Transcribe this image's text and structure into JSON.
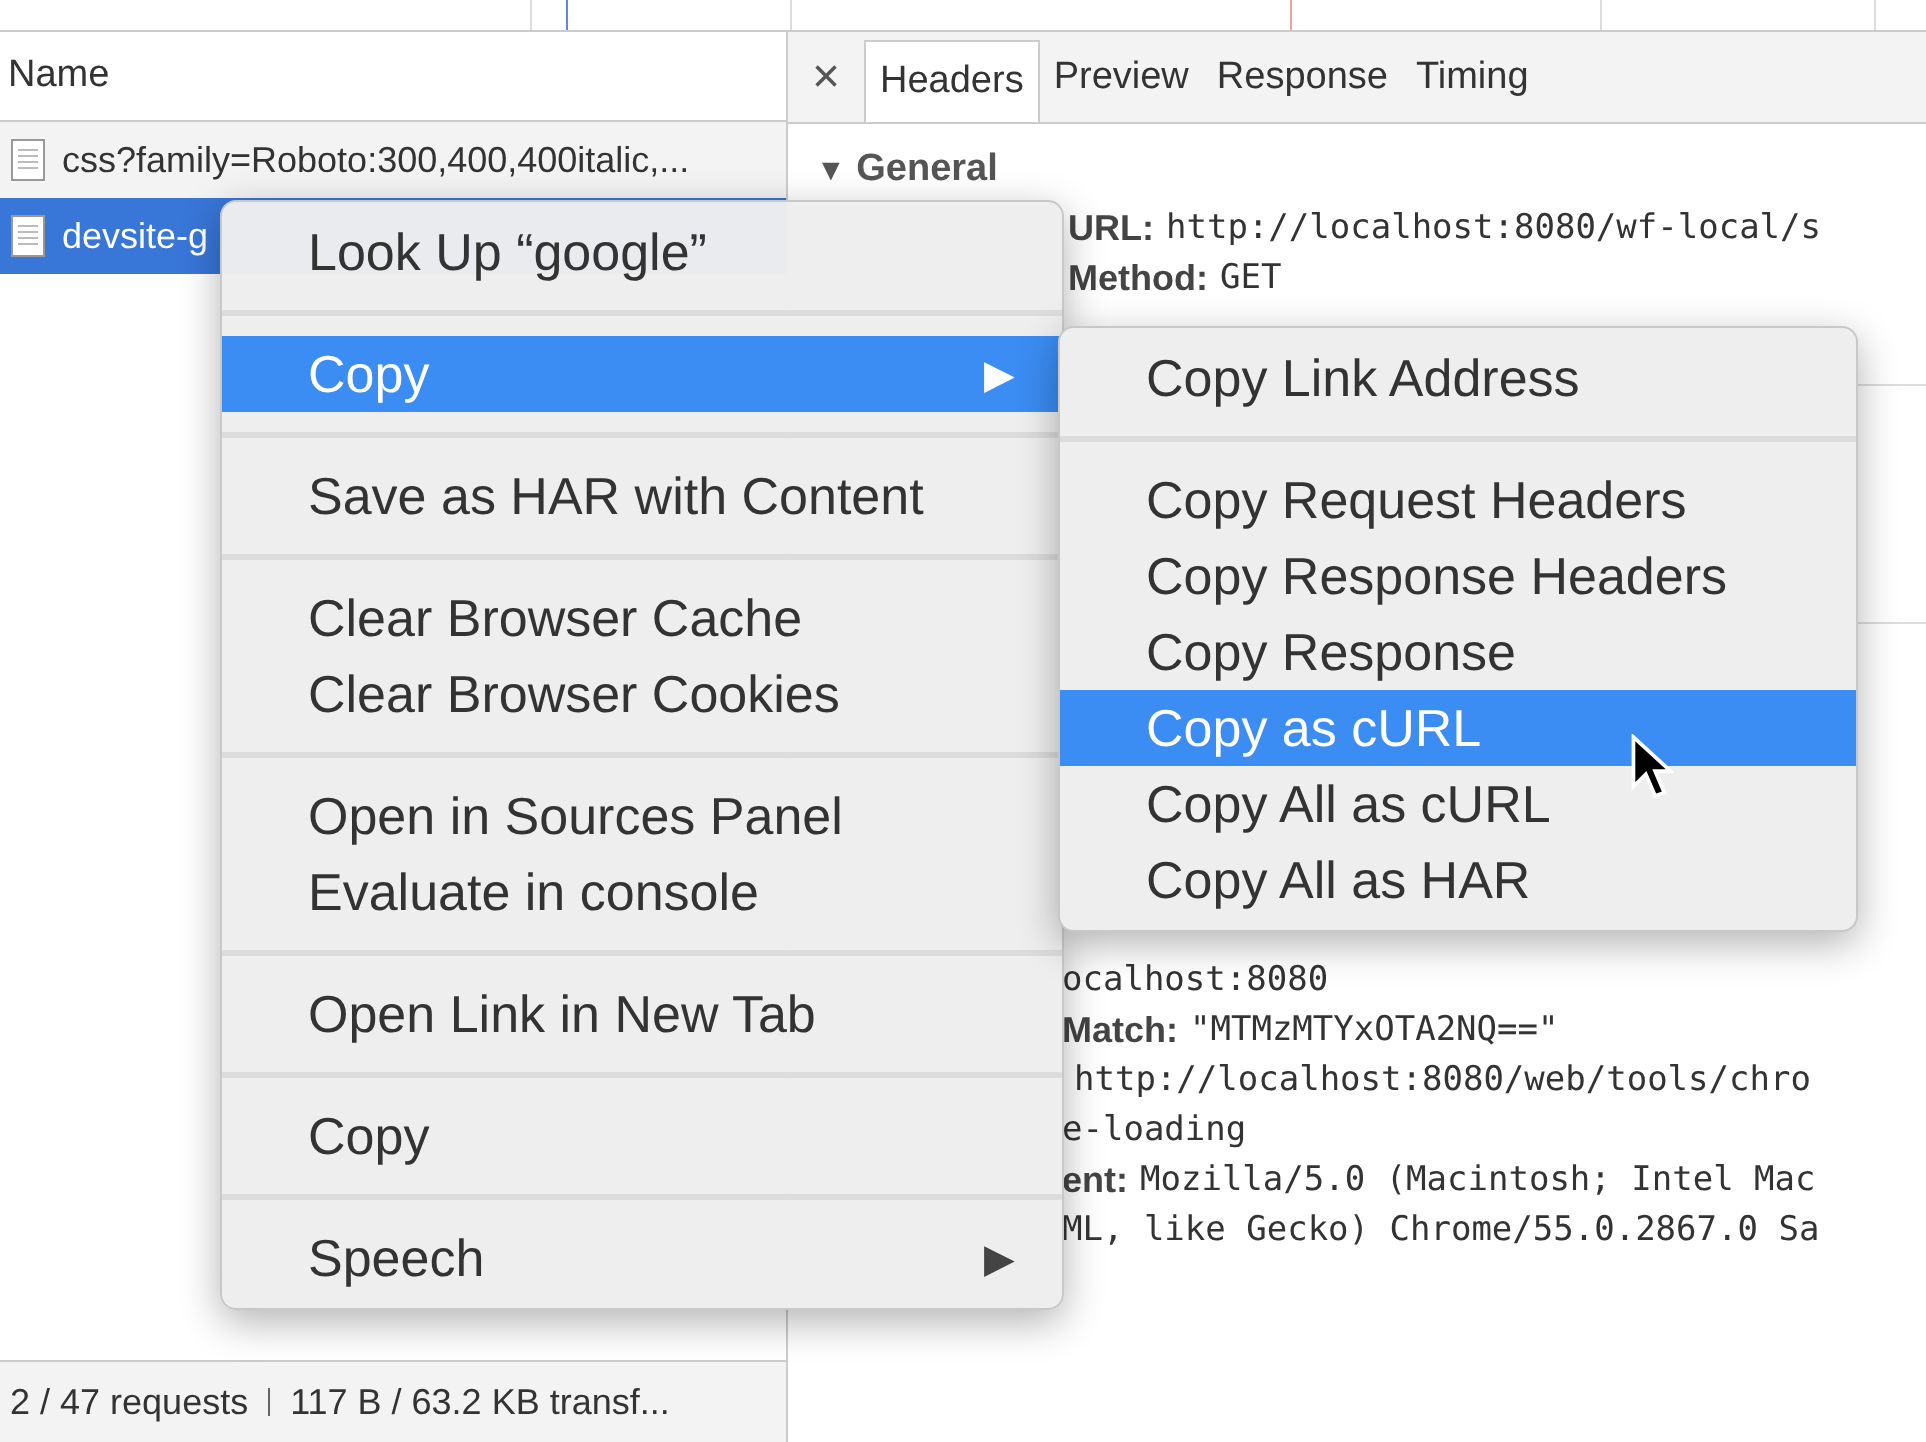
{
  "requests_panel": {
    "column_header": "Name",
    "rows": [
      {
        "name": "css?family=Roboto:300,400,400italic,...",
        "selected": false
      },
      {
        "name": "devsite-g",
        "selected": true
      }
    ],
    "status_bar": {
      "requests": "2 / 47 requests",
      "transferred": "117 B / 63.2 KB transf..."
    }
  },
  "details_panel": {
    "close": "×",
    "tabs": [
      {
        "label": "Headers",
        "selected": true
      },
      {
        "label": "Preview",
        "selected": false
      },
      {
        "label": "Response",
        "selected": false
      },
      {
        "label": "Timing",
        "selected": false
      }
    ],
    "section": {
      "title": "General",
      "toggle": "▼",
      "expanded": true
    },
    "general_rows": [
      {
        "key": "URL:",
        "value": "http://localhost:8080/wf-local/s"
      },
      {
        "key": "Method:",
        "value": "GET"
      }
    ],
    "header_rows": [
      {
        "key": "",
        "value": "ocalhost:8080"
      },
      {
        "key": "Match:",
        "value": "\"MTMzMTYxOTA2NQ==\""
      },
      {
        "key": "",
        "value": "http://localhost:8080/web/tools/chro"
      },
      {
        "key": "",
        "value": "e-loading"
      },
      {
        "key": "ent:",
        "value": "Mozilla/5.0 (Macintosh; Intel Mac"
      },
      {
        "key": "",
        "value": "ML, like Gecko) Chrome/55.0.2867.0 Sa"
      }
    ]
  },
  "context_menu": {
    "groups": [
      [
        {
          "label": "Look Up “google”",
          "selected": false,
          "submenu": false
        }
      ],
      [
        {
          "label": "Copy",
          "selected": true,
          "submenu": true
        }
      ],
      [
        {
          "label": "Save as HAR with Content",
          "selected": false,
          "submenu": false
        }
      ],
      [
        {
          "label": "Clear Browser Cache",
          "selected": false,
          "submenu": false
        },
        {
          "label": "Clear Browser Cookies",
          "selected": false,
          "submenu": false
        }
      ],
      [
        {
          "label": "Open in Sources Panel",
          "selected": false,
          "submenu": false
        },
        {
          "label": "Evaluate in console",
          "selected": false,
          "submenu": false
        }
      ],
      [
        {
          "label": "Open Link in New Tab",
          "selected": false,
          "submenu": false
        }
      ],
      [
        {
          "label": "Copy",
          "selected": false,
          "submenu": false
        }
      ],
      [
        {
          "label": "Speech",
          "selected": false,
          "submenu": true
        }
      ]
    ],
    "arrow": "▶"
  },
  "submenu": {
    "groups": [
      [
        {
          "label": "Copy Link Address",
          "selected": false
        }
      ],
      [
        {
          "label": "Copy Request Headers",
          "selected": false
        },
        {
          "label": "Copy Response Headers",
          "selected": false
        },
        {
          "label": "Copy Response",
          "selected": false
        },
        {
          "label": "Copy as cURL",
          "selected": true
        },
        {
          "label": "Copy All as cURL",
          "selected": false
        },
        {
          "label": "Copy All as HAR",
          "selected": false
        }
      ]
    ]
  }
}
